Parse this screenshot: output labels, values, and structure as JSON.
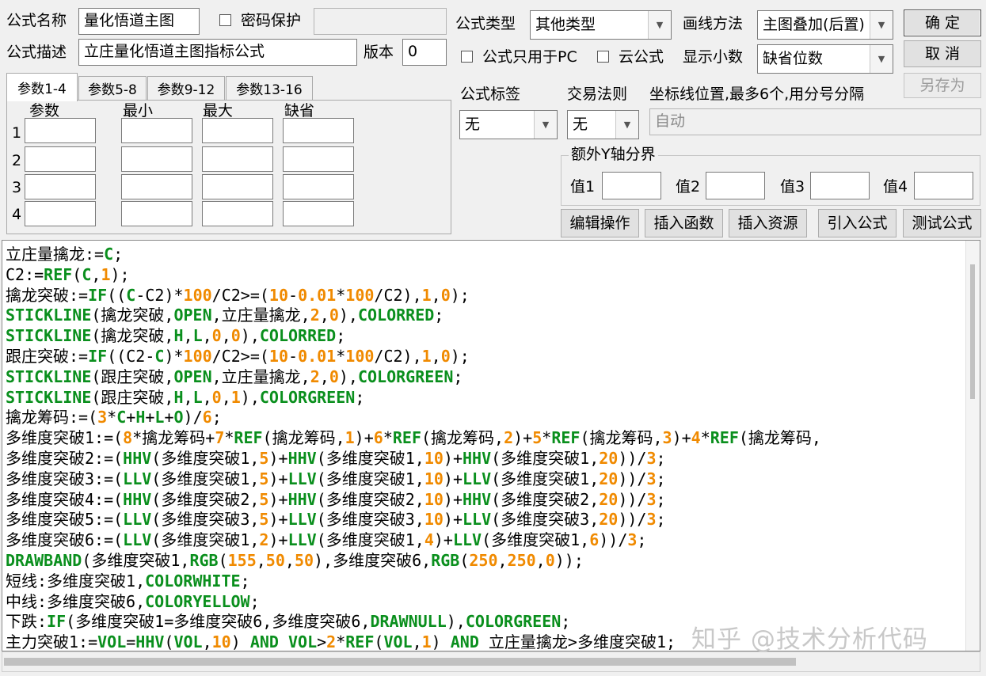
{
  "header": {
    "name_label": "公式名称",
    "name_value": "量化悟道主图",
    "password_label": "密码保护",
    "password_value": "",
    "desc_label": "公式描述",
    "desc_value": "立庄量化悟道主图指标公式",
    "version_label": "版本",
    "version_value": "0",
    "type_label": "公式类型",
    "type_value": "其他类型",
    "draw_label": "画线方法",
    "draw_value": "主图叠加(后置)",
    "pc_only_label": "公式只用于PC",
    "cloud_label": "云公式",
    "decimal_label": "显示小数",
    "decimal_value": "缺省位数"
  },
  "buttons": {
    "ok": "确  定",
    "cancel": "取  消",
    "save_as": "另存为",
    "edit_ops": "编辑操作",
    "insert_func": "插入函数",
    "insert_res": "插入资源",
    "import_formula": "引入公式",
    "test_formula": "测试公式"
  },
  "tabs": [
    "参数1-4",
    "参数5-8",
    "参数9-12",
    "参数13-16"
  ],
  "params": {
    "headers": [
      "参数",
      "最小",
      "最大",
      "缺省"
    ],
    "rows": [
      "1",
      "2",
      "3",
      "4"
    ]
  },
  "tag": {
    "label": "公式标签",
    "value": "无"
  },
  "rule": {
    "label": "交易法则",
    "value": "无"
  },
  "axis": {
    "label": "坐标线位置,最多6个,用分号分隔",
    "value": "自动"
  },
  "yaxis": {
    "title": "额外Y轴分界",
    "labels": [
      "值1",
      "值2",
      "值3",
      "值4"
    ]
  },
  "code_lines": [
    [
      [
        "t",
        "立庄量擒龙:="
      ],
      [
        "k",
        "C"
      ],
      [
        "t",
        ";"
      ]
    ],
    [
      [
        "t",
        "C2:="
      ],
      [
        "k",
        "REF"
      ],
      [
        "t",
        "("
      ],
      [
        "k",
        "C"
      ],
      [
        "t",
        ","
      ],
      [
        "n",
        "1"
      ],
      [
        "t",
        ");"
      ]
    ],
    [
      [
        "t",
        "擒龙突破:="
      ],
      [
        "k",
        "IF"
      ],
      [
        "t",
        "(("
      ],
      [
        "k",
        "C"
      ],
      [
        "t",
        "-C2)*"
      ],
      [
        "n",
        "100"
      ],
      [
        "t",
        "/C2>=("
      ],
      [
        "n",
        "10"
      ],
      [
        "t",
        "-"
      ],
      [
        "n",
        "0.01"
      ],
      [
        "t",
        "*"
      ],
      [
        "n",
        "100"
      ],
      [
        "t",
        "/C2),"
      ],
      [
        "n",
        "1"
      ],
      [
        "t",
        ","
      ],
      [
        "n",
        "0"
      ],
      [
        "t",
        ");"
      ]
    ],
    [
      [
        "k",
        "STICKLINE"
      ],
      [
        "t",
        "(擒龙突破,"
      ],
      [
        "k",
        "OPEN"
      ],
      [
        "t",
        ",立庄量擒龙,"
      ],
      [
        "n",
        "2"
      ],
      [
        "t",
        ","
      ],
      [
        "n",
        "0"
      ],
      [
        "t",
        "),"
      ],
      [
        "k",
        "COLORRED"
      ],
      [
        "t",
        ";"
      ]
    ],
    [
      [
        "k",
        "STICKLINE"
      ],
      [
        "t",
        "(擒龙突破,"
      ],
      [
        "k",
        "H"
      ],
      [
        "t",
        ","
      ],
      [
        "k",
        "L"
      ],
      [
        "t",
        ","
      ],
      [
        "n",
        "0"
      ],
      [
        "t",
        ","
      ],
      [
        "n",
        "0"
      ],
      [
        "t",
        "),"
      ],
      [
        "k",
        "COLORRED"
      ],
      [
        "t",
        ";"
      ]
    ],
    [
      [
        "t",
        "跟庄突破:="
      ],
      [
        "k",
        "IF"
      ],
      [
        "t",
        "((C2-"
      ],
      [
        "k",
        "C"
      ],
      [
        "t",
        ")*"
      ],
      [
        "n",
        "100"
      ],
      [
        "t",
        "/C2>=("
      ],
      [
        "n",
        "10"
      ],
      [
        "t",
        "-"
      ],
      [
        "n",
        "0.01"
      ],
      [
        "t",
        "*"
      ],
      [
        "n",
        "100"
      ],
      [
        "t",
        "/C2),"
      ],
      [
        "n",
        "1"
      ],
      [
        "t",
        ","
      ],
      [
        "n",
        "0"
      ],
      [
        "t",
        ");"
      ]
    ],
    [
      [
        "k",
        "STICKLINE"
      ],
      [
        "t",
        "(跟庄突破,"
      ],
      [
        "k",
        "OPEN"
      ],
      [
        "t",
        ",立庄量擒龙,"
      ],
      [
        "n",
        "2"
      ],
      [
        "t",
        ","
      ],
      [
        "n",
        "0"
      ],
      [
        "t",
        "),"
      ],
      [
        "k",
        "COLORGREEN"
      ],
      [
        "t",
        ";"
      ]
    ],
    [
      [
        "k",
        "STICKLINE"
      ],
      [
        "t",
        "(跟庄突破,"
      ],
      [
        "k",
        "H"
      ],
      [
        "t",
        ","
      ],
      [
        "k",
        "L"
      ],
      [
        "t",
        ","
      ],
      [
        "n",
        "0"
      ],
      [
        "t",
        ","
      ],
      [
        "n",
        "1"
      ],
      [
        "t",
        "),"
      ],
      [
        "k",
        "COLORGREEN"
      ],
      [
        "t",
        ";"
      ]
    ],
    [
      [
        "t",
        "擒龙筹码:=("
      ],
      [
        "n",
        "3"
      ],
      [
        "t",
        "*"
      ],
      [
        "k",
        "C"
      ],
      [
        "t",
        "+"
      ],
      [
        "k",
        "H"
      ],
      [
        "t",
        "+"
      ],
      [
        "k",
        "L"
      ],
      [
        "t",
        "+"
      ],
      [
        "k",
        "O"
      ],
      [
        "t",
        ")/"
      ],
      [
        "n",
        "6"
      ],
      [
        "t",
        ";"
      ]
    ],
    [
      [
        "t",
        "多维度突破1:=("
      ],
      [
        "n",
        "8"
      ],
      [
        "t",
        "*擒龙筹码+"
      ],
      [
        "n",
        "7"
      ],
      [
        "t",
        "*"
      ],
      [
        "k",
        "REF"
      ],
      [
        "t",
        "(擒龙筹码,"
      ],
      [
        "n",
        "1"
      ],
      [
        "t",
        ")+"
      ],
      [
        "n",
        "6"
      ],
      [
        "t",
        "*"
      ],
      [
        "k",
        "REF"
      ],
      [
        "t",
        "(擒龙筹码,"
      ],
      [
        "n",
        "2"
      ],
      [
        "t",
        ")+"
      ],
      [
        "n",
        "5"
      ],
      [
        "t",
        "*"
      ],
      [
        "k",
        "REF"
      ],
      [
        "t",
        "(擒龙筹码,"
      ],
      [
        "n",
        "3"
      ],
      [
        "t",
        ")+"
      ],
      [
        "n",
        "4"
      ],
      [
        "t",
        "*"
      ],
      [
        "k",
        "REF"
      ],
      [
        "t",
        "(擒龙筹码,"
      ]
    ],
    [
      [
        "t",
        "多维度突破2:=("
      ],
      [
        "k",
        "HHV"
      ],
      [
        "t",
        "(多维度突破1,"
      ],
      [
        "n",
        "5"
      ],
      [
        "t",
        ")+"
      ],
      [
        "k",
        "HHV"
      ],
      [
        "t",
        "(多维度突破1,"
      ],
      [
        "n",
        "10"
      ],
      [
        "t",
        ")+"
      ],
      [
        "k",
        "HHV"
      ],
      [
        "t",
        "(多维度突破1,"
      ],
      [
        "n",
        "20"
      ],
      [
        "t",
        "))/"
      ],
      [
        "n",
        "3"
      ],
      [
        "t",
        ";"
      ]
    ],
    [
      [
        "t",
        "多维度突破3:=("
      ],
      [
        "k",
        "LLV"
      ],
      [
        "t",
        "(多维度突破1,"
      ],
      [
        "n",
        "5"
      ],
      [
        "t",
        ")+"
      ],
      [
        "k",
        "LLV"
      ],
      [
        "t",
        "(多维度突破1,"
      ],
      [
        "n",
        "10"
      ],
      [
        "t",
        ")+"
      ],
      [
        "k",
        "LLV"
      ],
      [
        "t",
        "(多维度突破1,"
      ],
      [
        "n",
        "20"
      ],
      [
        "t",
        "))/"
      ],
      [
        "n",
        "3"
      ],
      [
        "t",
        ";"
      ]
    ],
    [
      [
        "t",
        "多维度突破4:=("
      ],
      [
        "k",
        "HHV"
      ],
      [
        "t",
        "(多维度突破2,"
      ],
      [
        "n",
        "5"
      ],
      [
        "t",
        ")+"
      ],
      [
        "k",
        "HHV"
      ],
      [
        "t",
        "(多维度突破2,"
      ],
      [
        "n",
        "10"
      ],
      [
        "t",
        ")+"
      ],
      [
        "k",
        "HHV"
      ],
      [
        "t",
        "(多维度突破2,"
      ],
      [
        "n",
        "20"
      ],
      [
        "t",
        "))/"
      ],
      [
        "n",
        "3"
      ],
      [
        "t",
        ";"
      ]
    ],
    [
      [
        "t",
        "多维度突破5:=("
      ],
      [
        "k",
        "LLV"
      ],
      [
        "t",
        "(多维度突破3,"
      ],
      [
        "n",
        "5"
      ],
      [
        "t",
        ")+"
      ],
      [
        "k",
        "LLV"
      ],
      [
        "t",
        "(多维度突破3,"
      ],
      [
        "n",
        "10"
      ],
      [
        "t",
        ")+"
      ],
      [
        "k",
        "LLV"
      ],
      [
        "t",
        "(多维度突破3,"
      ],
      [
        "n",
        "20"
      ],
      [
        "t",
        "))/"
      ],
      [
        "n",
        "3"
      ],
      [
        "t",
        ";"
      ]
    ],
    [
      [
        "t",
        "多维度突破6:=("
      ],
      [
        "k",
        "LLV"
      ],
      [
        "t",
        "(多维度突破1,"
      ],
      [
        "n",
        "2"
      ],
      [
        "t",
        ")+"
      ],
      [
        "k",
        "LLV"
      ],
      [
        "t",
        "(多维度突破1,"
      ],
      [
        "n",
        "4"
      ],
      [
        "t",
        ")+"
      ],
      [
        "k",
        "LLV"
      ],
      [
        "t",
        "(多维度突破1,"
      ],
      [
        "n",
        "6"
      ],
      [
        "t",
        "))/"
      ],
      [
        "n",
        "3"
      ],
      [
        "t",
        ";"
      ]
    ],
    [
      [
        "k",
        "DRAWBAND"
      ],
      [
        "t",
        "(多维度突破1,"
      ],
      [
        "k",
        "RGB"
      ],
      [
        "t",
        "("
      ],
      [
        "n",
        "155"
      ],
      [
        "t",
        ","
      ],
      [
        "n",
        "50"
      ],
      [
        "t",
        ","
      ],
      [
        "n",
        "50"
      ],
      [
        "t",
        "),多维度突破6,"
      ],
      [
        "k",
        "RGB"
      ],
      [
        "t",
        "("
      ],
      [
        "n",
        "250"
      ],
      [
        "t",
        ","
      ],
      [
        "n",
        "250"
      ],
      [
        "t",
        ","
      ],
      [
        "n",
        "0"
      ],
      [
        "t",
        "));"
      ]
    ],
    [
      [
        "t",
        "短线:多维度突破1,"
      ],
      [
        "k",
        "COLORWHITE"
      ],
      [
        "t",
        ";"
      ]
    ],
    [
      [
        "t",
        "中线:多维度突破6,"
      ],
      [
        "k",
        "COLORYELLOW"
      ],
      [
        "t",
        ";"
      ]
    ],
    [
      [
        "t",
        "下跌:"
      ],
      [
        "k",
        "IF"
      ],
      [
        "t",
        "(多维度突破1=多维度突破6,多维度突破6,"
      ],
      [
        "k",
        "DRAWNULL"
      ],
      [
        "t",
        "),"
      ],
      [
        "k",
        "COLORGREEN"
      ],
      [
        "t",
        ";"
      ]
    ],
    [
      [
        "t",
        "主力突破1:="
      ],
      [
        "k",
        "VOL"
      ],
      [
        "t",
        "="
      ],
      [
        "k",
        "HHV"
      ],
      [
        "t",
        "("
      ],
      [
        "k",
        "VOL"
      ],
      [
        "t",
        ","
      ],
      [
        "n",
        "10"
      ],
      [
        "t",
        ") "
      ],
      [
        "k",
        "AND"
      ],
      [
        "t",
        " "
      ],
      [
        "k",
        "VOL"
      ],
      [
        "t",
        ">"
      ],
      [
        "n",
        "2"
      ],
      [
        "t",
        "*"
      ],
      [
        "k",
        "REF"
      ],
      [
        "t",
        "("
      ],
      [
        "k",
        "VOL"
      ],
      [
        "t",
        ","
      ],
      [
        "n",
        "1"
      ],
      [
        "t",
        ") "
      ],
      [
        "k",
        "AND"
      ],
      [
        "t",
        " 立庄量擒龙>多维度突破1;"
      ]
    ]
  ],
  "watermark": "知乎 @技术分析代码"
}
